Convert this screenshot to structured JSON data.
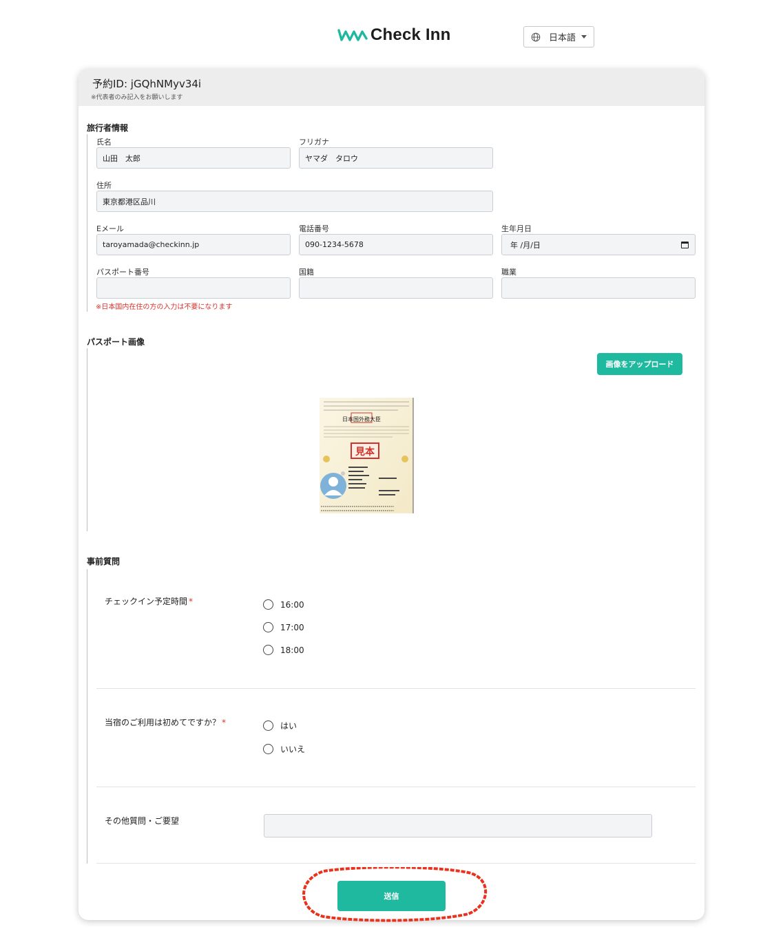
{
  "header": {
    "brand": "Check Inn",
    "language": "日本語"
  },
  "reservation": {
    "id_label": "予約ID: jGQhNMyv34i",
    "note": "※代表者のみ記入をお願いします"
  },
  "traveler": {
    "section_title": "旅行者情報",
    "name_label": "氏名",
    "name_value": "山田　太郎",
    "furigana_label": "フリガナ",
    "furigana_value": "ヤマダ　タロウ",
    "address_label": "住所",
    "address_value": "東京都港区品川",
    "email_label": "Eメール",
    "email_value": "taroyamada@checkinn.jp",
    "phone_label": "電話番号",
    "phone_value": "090-1234-5678",
    "birthday_label": "生年月日",
    "birthday_placeholder": "年 /月/日",
    "passport_label": "パスポート番号",
    "passport_value": "",
    "nationality_label": "国籍",
    "nationality_value": "",
    "occupation_label": "職業",
    "occupation_value": "",
    "warning": "※日本国内在住の方の入力は不要になります"
  },
  "passport_image": {
    "section_title": "パスポート画像",
    "upload_label": "画像をアップロード",
    "stamp_text": "見本",
    "issuer_text": "日本国外務大臣"
  },
  "questions": {
    "section_title": "事前質問",
    "checkin_label": "チェックイン予定時間",
    "checkin_options": [
      "16:00",
      "17:00",
      "18:00"
    ],
    "first_time_label": "当宿のご利用は初めてですか？",
    "first_time_options": [
      "はい",
      "いいえ"
    ],
    "other_label": "その他質問・ご要望",
    "required_mark": "*"
  },
  "submit_label": "送信",
  "colors": {
    "accent": "#1fb9a0",
    "warning": "#d9332b",
    "annotation": "#e8321e"
  }
}
